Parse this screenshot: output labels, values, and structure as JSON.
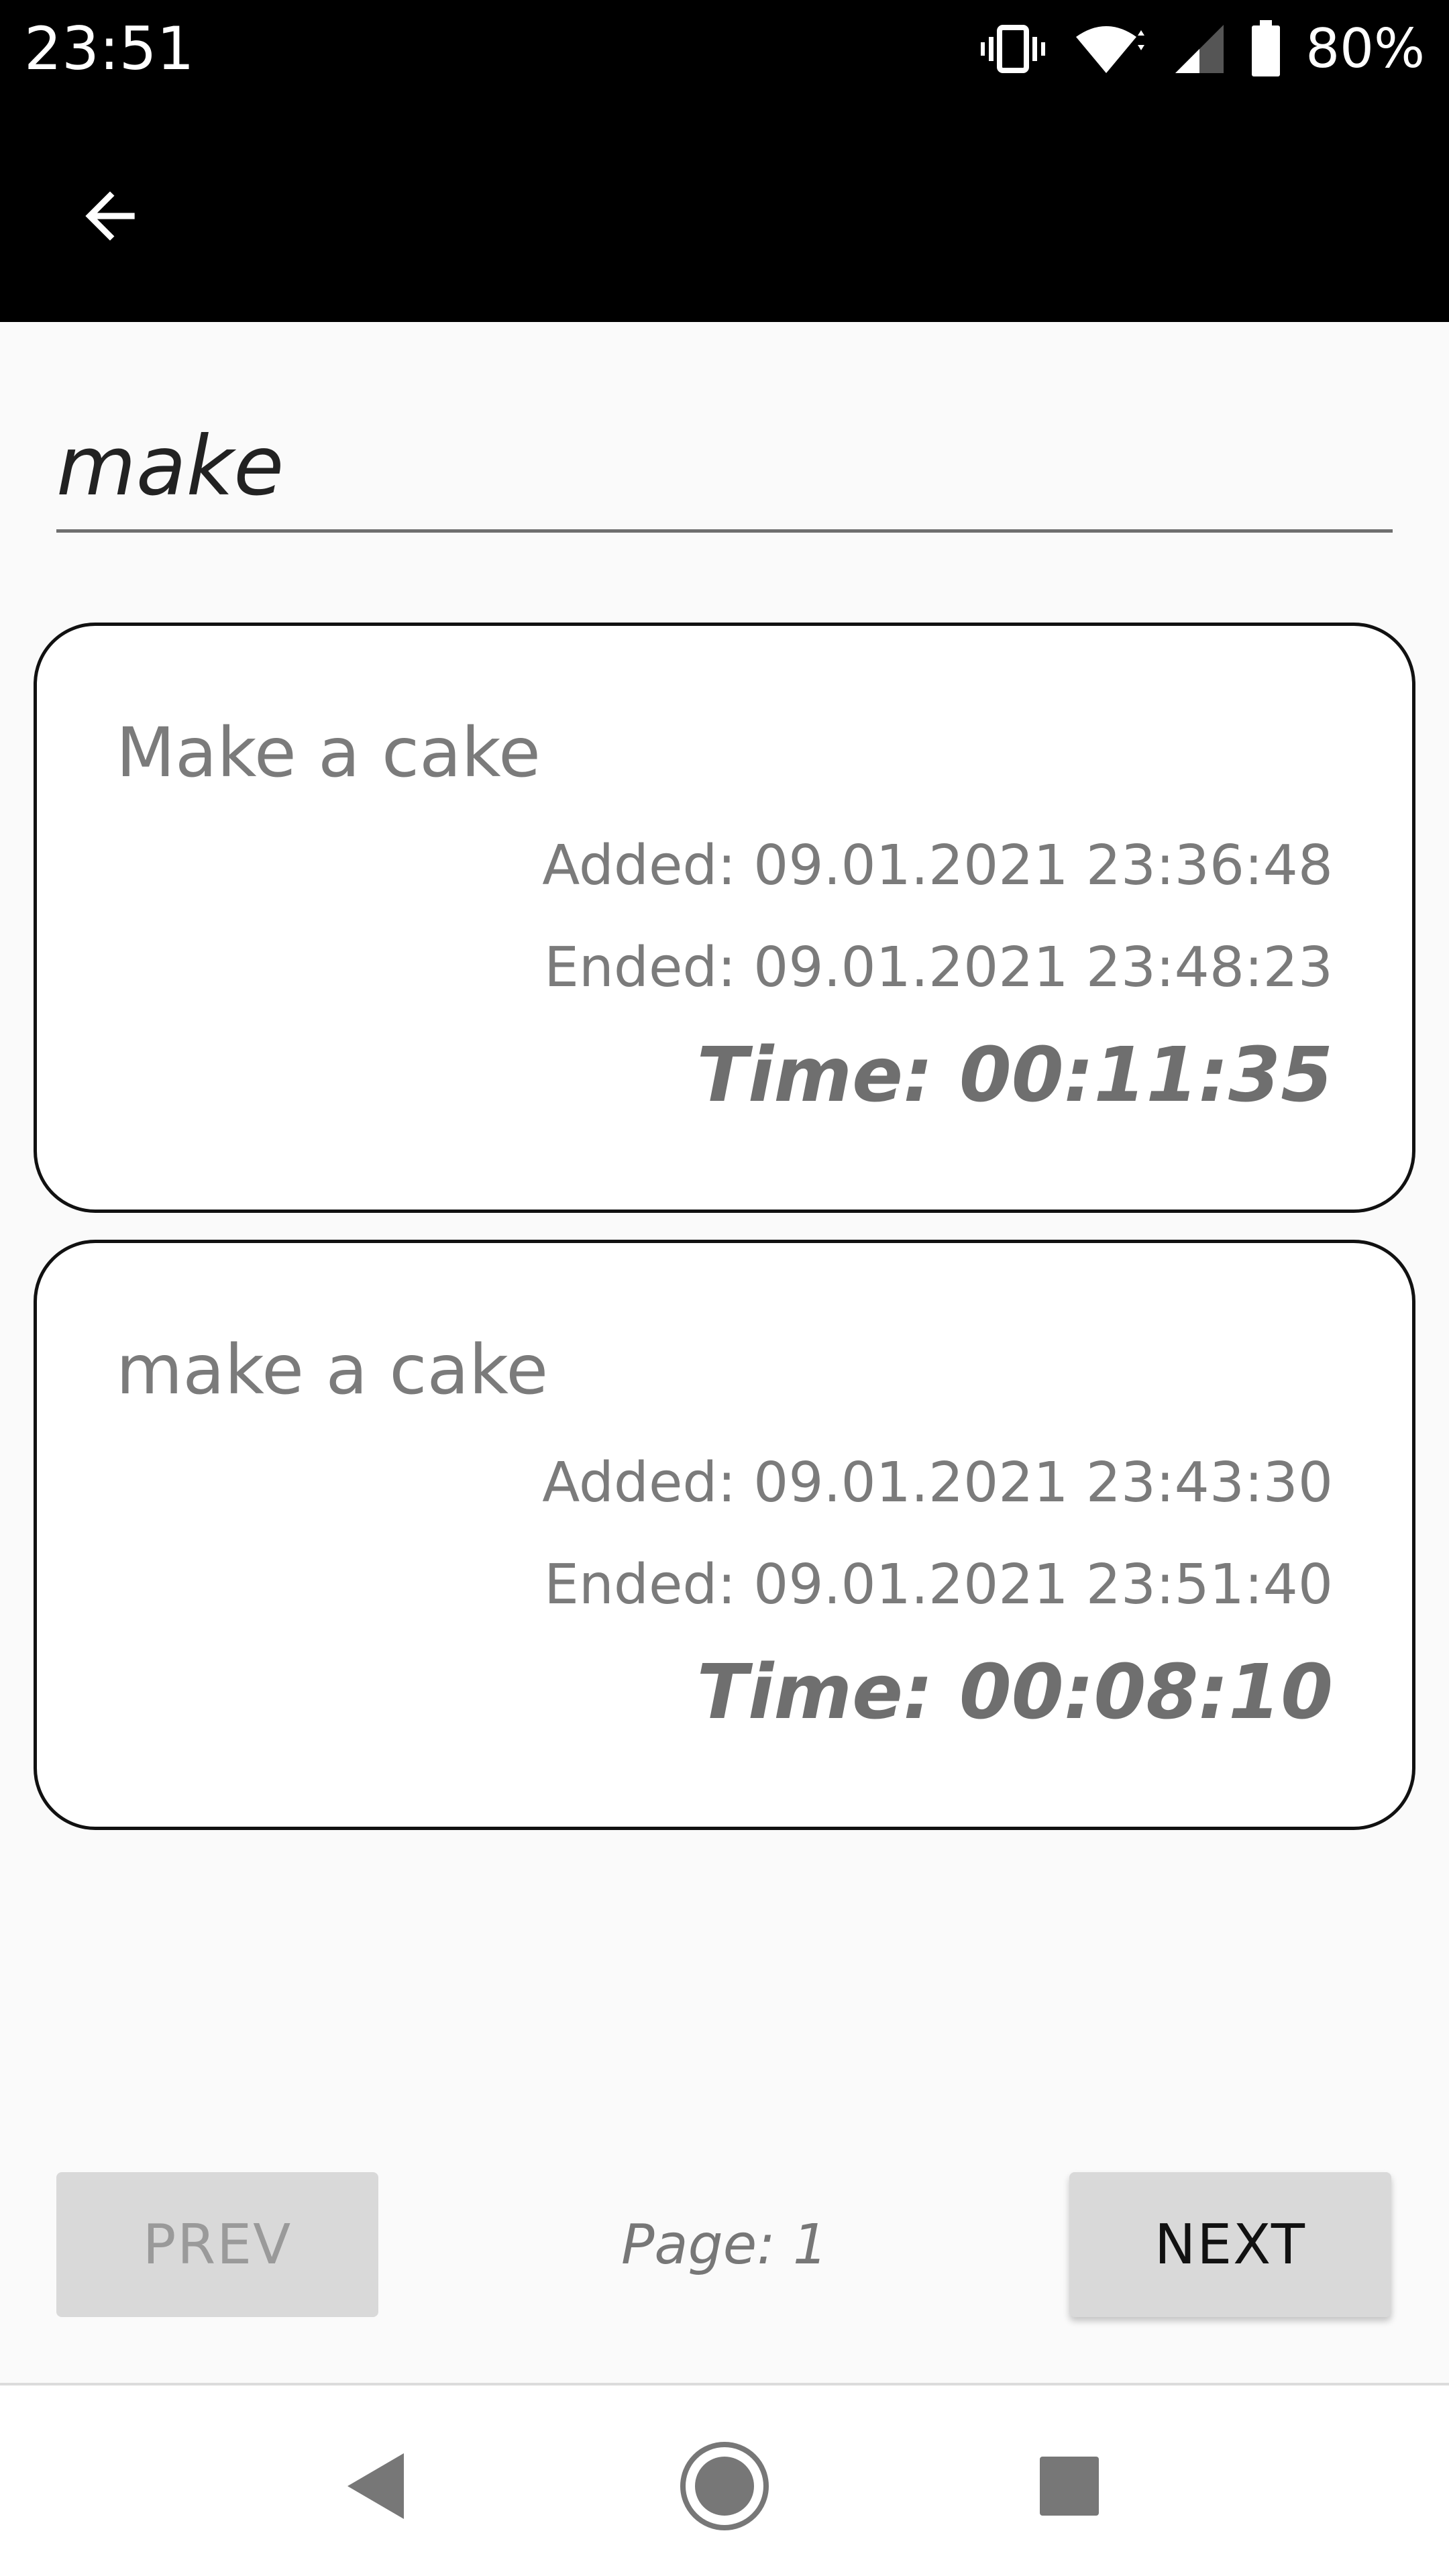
{
  "status_bar": {
    "time": "23:51",
    "battery": "80%",
    "icons": [
      "vibrate-icon",
      "wifi-icon",
      "signal-icon",
      "battery-icon"
    ]
  },
  "app_bar": {
    "back_icon": "arrow-back-icon"
  },
  "search": {
    "value": "make"
  },
  "cards": [
    {
      "title": "Make a cake",
      "added": "Added: 09.01.2021 23:36:48",
      "ended": "Ended: 09.01.2021 23:48:23",
      "time": "Time: 00:11:35"
    },
    {
      "title": "make a cake",
      "added": "Added: 09.01.2021 23:43:30",
      "ended": "Ended: 09.01.2021 23:51:40",
      "time": "Time: 00:08:10"
    }
  ],
  "pagination": {
    "prev_label": "PREV",
    "next_label": "NEXT",
    "page_label": "Page: 1"
  },
  "nav_bar": {
    "icons": [
      "nav-back-icon",
      "nav-home-icon",
      "nav-recents-icon"
    ]
  },
  "colors": {
    "status_bar_bg": "#000000",
    "card_text": "#7b7b7b",
    "button_bg": "#d9d9d9"
  }
}
